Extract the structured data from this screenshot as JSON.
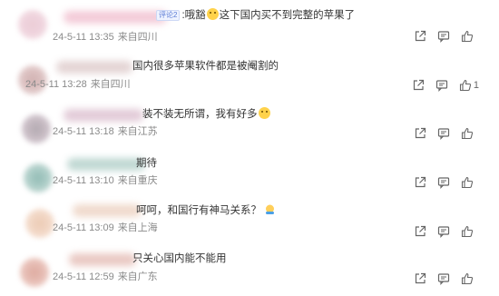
{
  "comments": [
    {
      "badge": "评论2",
      "text_before": ":哦豁",
      "text_after": "这下国内买不到完整的苹果了",
      "emoji": "face-emoji",
      "time": "24-5-11 13:35",
      "location": "来自四川",
      "likes": "",
      "colors": [
        "#e9c3cf",
        "#f2d9e2"
      ]
    },
    {
      "text_before": "国内很多苹果软件都是被阉割的",
      "text_after": "",
      "time": "24-5-11 13:28",
      "location": "来自四川",
      "likes": "1",
      "colors": [
        "#c9a4a4",
        "#e7cfcf"
      ]
    },
    {
      "text_before": "装不装无所谓，我有好多",
      "text_after": "",
      "emoji": "face-emoji",
      "time": "24-5-11 13:18",
      "location": "来自江苏",
      "likes": "",
      "colors": [
        "#a79ca4",
        "#d9c8d3"
      ]
    },
    {
      "text_before": "期待",
      "text_after": "",
      "time": "24-5-11 13:10",
      "location": "来自重庆",
      "likes": "",
      "colors": [
        "#7fb1a9",
        "#c8ddd8"
      ]
    },
    {
      "text_before": "呵呵，和国行有神马关系？",
      "text_after": "",
      "emoji": "thinking-emoji",
      "time": "24-5-11 13:09",
      "location": "来自上海",
      "likes": "",
      "colors": [
        "#eac2a8",
        "#f6e1d3"
      ]
    },
    {
      "text_before": "只关心国内能不能用",
      "text_after": "",
      "time": "24-5-11 12:59",
      "location": "来自广东",
      "likes": "",
      "colors": [
        "#d89b8f",
        "#f0cfc7"
      ]
    }
  ],
  "icons": {
    "share": "share-icon",
    "comment": "comment-icon",
    "like": "thumbs-up-icon"
  }
}
